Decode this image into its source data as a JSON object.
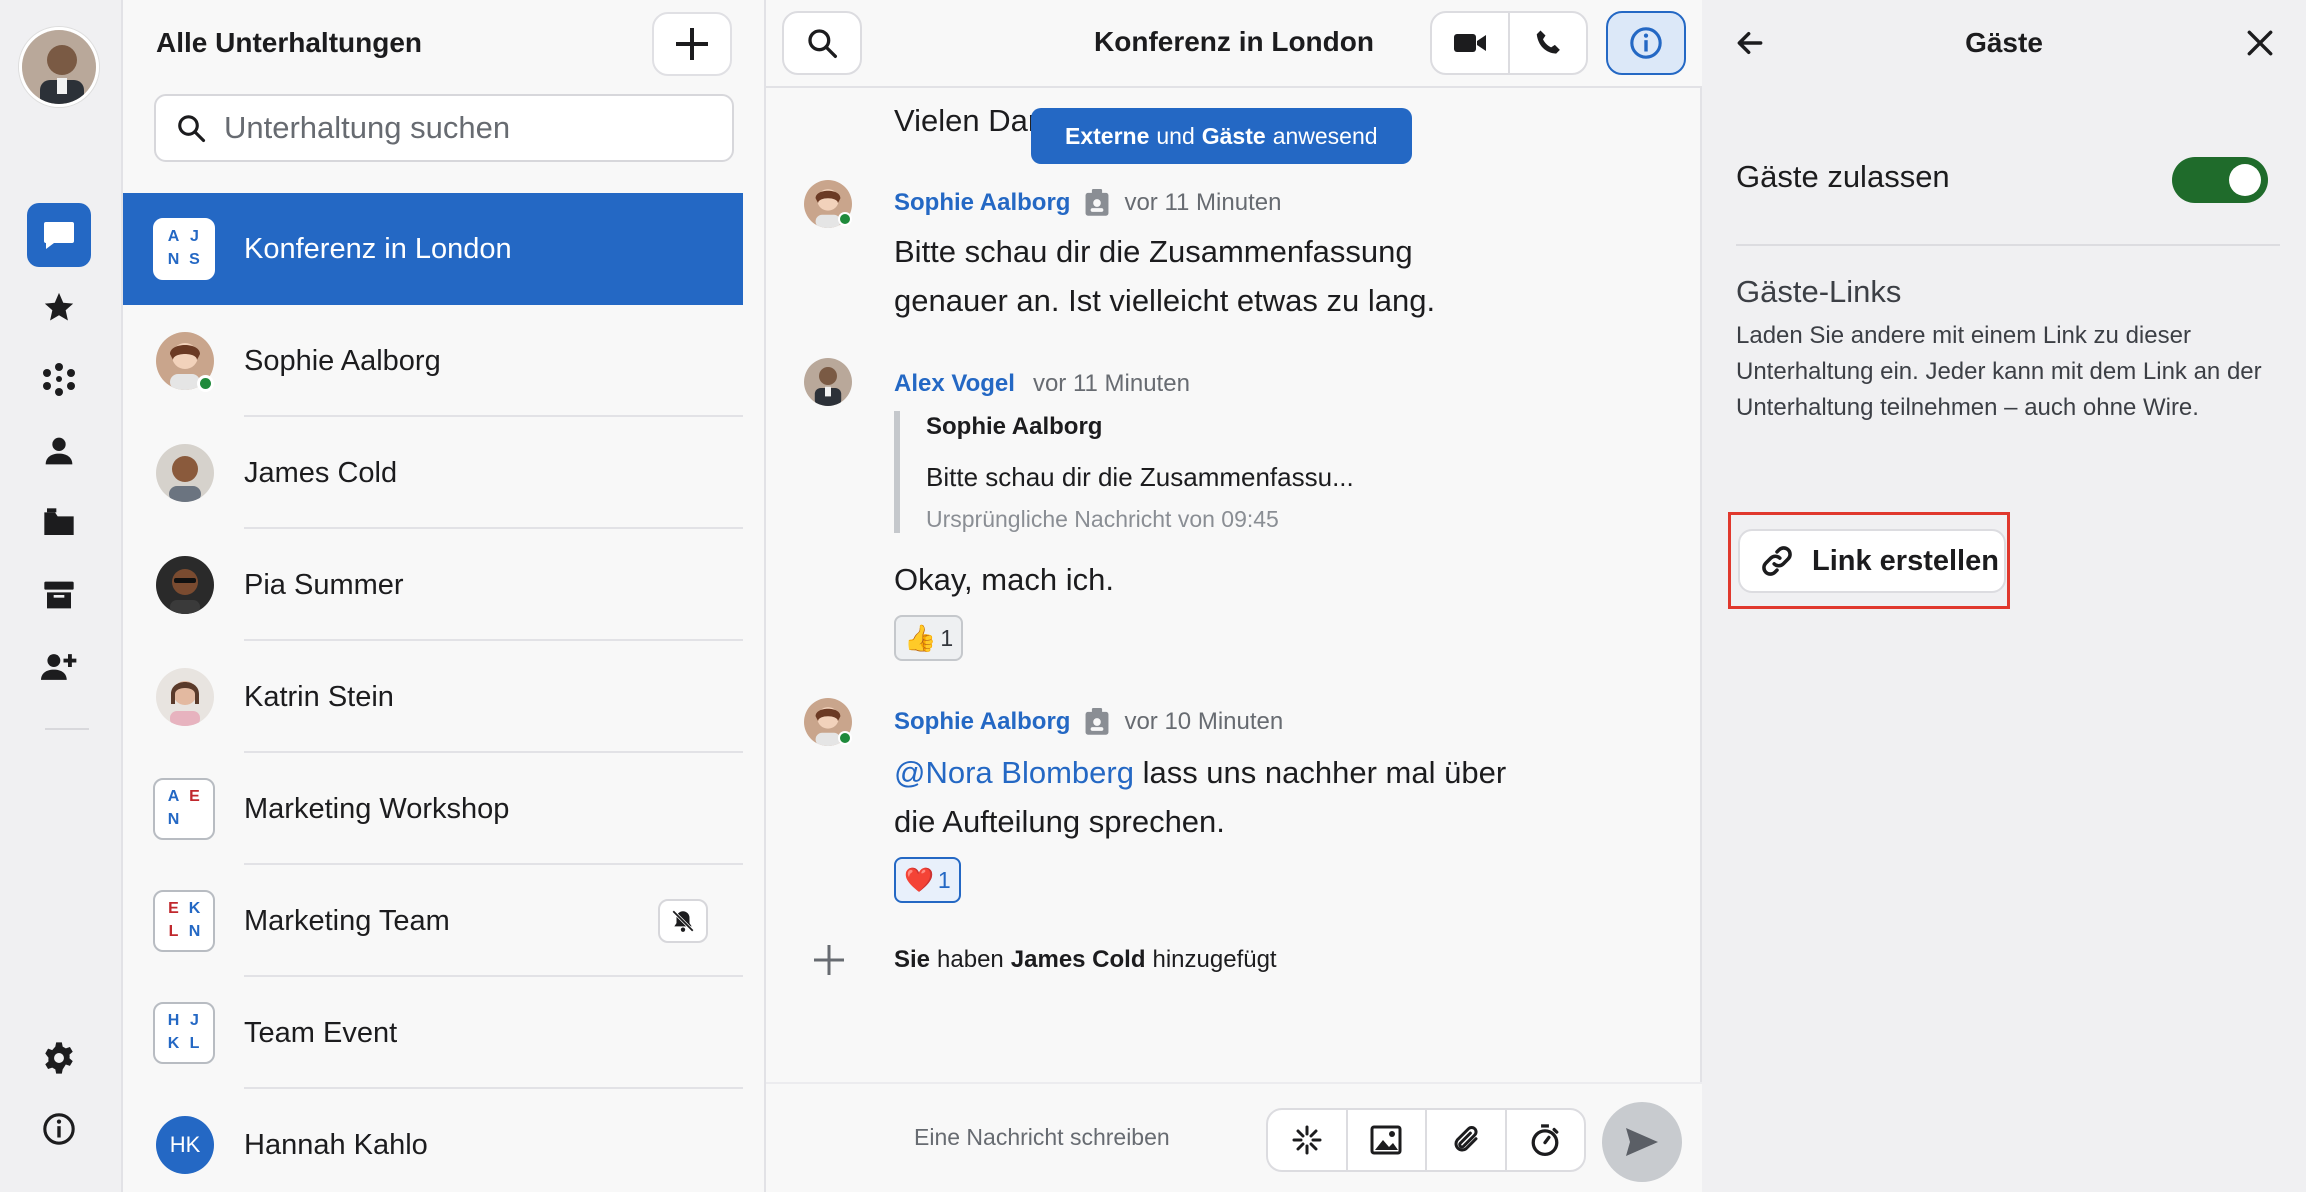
{
  "colors": {
    "accent": "#2468c4",
    "online": "#1f8a3b",
    "toggle_on": "#1f6b2b",
    "highlight": "#e0382d"
  },
  "rail": {
    "items": [
      "chat-icon",
      "star-icon",
      "dots-circle-icon",
      "person-icon",
      "folder-icon",
      "archive-icon",
      "add-person-icon"
    ],
    "bottom": [
      "gear-icon",
      "info-icon"
    ]
  },
  "conversations": {
    "title": "Alle Unterhaltungen",
    "search_placeholder": "Unterhaltung suchen",
    "items": [
      {
        "name": "Konferenz in London",
        "initials": [
          "A",
          "J",
          "N",
          "S"
        ]
      },
      {
        "name": "Sophie Aalborg"
      },
      {
        "name": "James Cold"
      },
      {
        "name": "Pia Summer"
      },
      {
        "name": "Katrin Stein"
      },
      {
        "name": "Marketing Workshop",
        "initials": [
          "A",
          "E",
          "N",
          ""
        ]
      },
      {
        "name": "Marketing Team",
        "initials": [
          "E",
          "K",
          "L",
          "N"
        ]
      },
      {
        "name": "Team Event",
        "initials": [
          "H",
          "J",
          "K",
          "L"
        ]
      },
      {
        "name": "Hannah Kahlo",
        "initials_text": "HK"
      }
    ]
  },
  "chat": {
    "title": "Konferenz in London",
    "tooltip": {
      "part1": "Externe",
      "part2": "und",
      "part3": "Gäste",
      "part4": "anwesend"
    },
    "partial_message": "Vielen Dank!",
    "messages": [
      {
        "author": "Sophie Aalborg",
        "time": "vor 11 Minuten",
        "line1": "Bitte schau dir die Zusammenfassung",
        "line2": "genauer an. Ist vielleicht etwas zu lang."
      },
      {
        "author": "Alex Vogel",
        "time": "vor 11 Minuten",
        "quote_author": "Sophie Aalborg",
        "quote_text": "Bitte schau dir die Zusammenfassu...",
        "quote_meta": "Ursprüngliche Nachricht von 09:45",
        "text": "Okay, mach ich.",
        "reaction_count": "1"
      },
      {
        "author": "Sophie Aalborg",
        "time": "vor 10 Minuten",
        "mention": "@Nora Blomberg",
        "line1_rest": " lass uns nachher mal über",
        "line2": "die Aufteilung sprechen.",
        "reaction_count": "1"
      }
    ],
    "system": {
      "actor": "Sie",
      "verb": "haben",
      "target": "James Cold",
      "action": "hinzugefügt"
    },
    "input_placeholder": "Eine Nachricht schreiben"
  },
  "guests": {
    "title": "Gäste",
    "toggle_label": "Gäste zulassen",
    "toggle_on": true,
    "links_title": "Gäste-Links",
    "links_desc": "Laden Sie andere mit einem Link zu dieser Unterhaltung ein. Jeder kann mit dem Link an der Unterhaltung teilnehmen – auch ohne Wire.",
    "create_link_label": "Link erstellen"
  }
}
